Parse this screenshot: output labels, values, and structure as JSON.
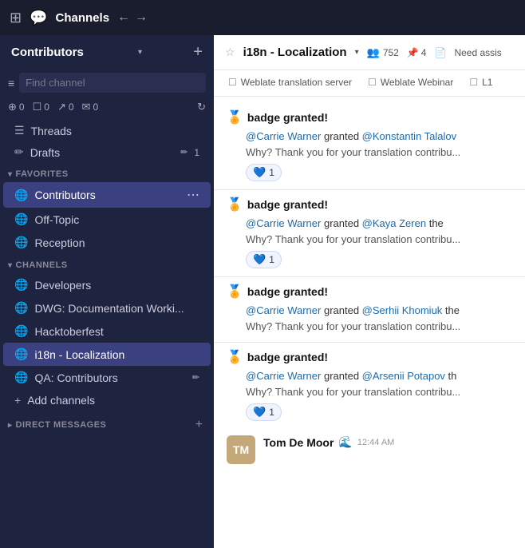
{
  "topbar": {
    "title": "Channels",
    "back_label": "←",
    "forward_label": "→"
  },
  "sidebar": {
    "workspace_name": "Contributors",
    "search_placeholder": "Find channel",
    "status_icons": [
      {
        "icon": "⊕",
        "count": "0"
      },
      {
        "icon": "☐",
        "count": "0"
      },
      {
        "icon": "↗",
        "count": "0"
      },
      {
        "icon": "✉",
        "count": "0"
      }
    ],
    "threads_label": "Threads",
    "drafts_label": "Drafts",
    "drafts_badge": "1",
    "favorites_header": "FAVORITES",
    "favorites": [
      {
        "label": "Contributors",
        "icon": "🌐",
        "active": true
      },
      {
        "label": "Off-Topic",
        "icon": "🌐",
        "active": false
      },
      {
        "label": "Reception",
        "icon": "🌐",
        "active": false
      }
    ],
    "channels_header": "CHANNELS",
    "channels": [
      {
        "label": "Developers",
        "icon": "🌐",
        "active": false
      },
      {
        "label": "DWG: Documentation Worki...",
        "icon": "🌐",
        "active": false
      },
      {
        "label": "Hacktoberfest",
        "icon": "🌐",
        "active": false
      },
      {
        "label": "i18n - Localization",
        "icon": "🌐",
        "active": true
      },
      {
        "label": "QA: Contributors",
        "icon": "🌐",
        "active": false
      }
    ],
    "add_channels_label": "Add channels",
    "direct_messages_header": "DIRECT MESSAGES",
    "direct_messages_add_label": "+"
  },
  "channel": {
    "name": "i18n - Localization",
    "members": "752",
    "pins": "4",
    "assist_label": "Need assis",
    "tabs": [
      {
        "label": "Weblate translation server"
      },
      {
        "label": "Weblate Webinar"
      },
      {
        "label": "L1"
      }
    ]
  },
  "messages": [
    {
      "badge_icon": "🏅",
      "badge_text": "badge granted!",
      "author": "@Carrie Warner",
      "mention": "@Konstantin Talalov",
      "suffix": "granted",
      "why_text": "Why? Thank you for your translation contribu...",
      "reaction_emoji": "💙",
      "reaction_count": "1"
    },
    {
      "badge_icon": "🏅",
      "badge_text": "badge granted!",
      "author": "@Carrie Warner",
      "mention": "@Kaya Zeren",
      "suffix": "granted the",
      "why_text": "Why? Thank you for your translation contribu...",
      "reaction_emoji": "💙",
      "reaction_count": "1"
    },
    {
      "badge_icon": "🏅",
      "badge_text": "badge granted!",
      "author": "@Carrie Warner",
      "mention": "@Serhii Khomiuk",
      "suffix": "the",
      "why_text": "Why? Thank you for your translation contribu...",
      "reaction_emoji": null,
      "reaction_count": null
    },
    {
      "badge_icon": "🏅",
      "badge_text": "badge granted!",
      "author": "@Carrie Warner",
      "mention": "@Arsenii Potapov",
      "suffix": "th",
      "why_text": "Why? Thank you for your translation contribu...",
      "reaction_emoji": "💙",
      "reaction_count": "1"
    }
  ],
  "user_message": {
    "avatar_initials": "TM",
    "name": "Tom De Moor",
    "emoji": "🌊",
    "time": "12:44 AM"
  }
}
